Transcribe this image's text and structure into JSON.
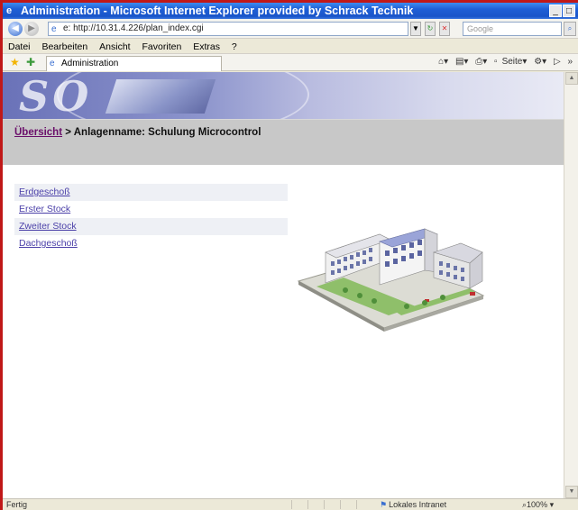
{
  "window": {
    "title": "Administration - Microsoft Internet Explorer provided by Schrack Technik",
    "minimize": "_",
    "restore": "□",
    "close": "X"
  },
  "address": {
    "url": "e: http://10.31.4.226/plan_index.cgi",
    "search_placeholder": "Google"
  },
  "menu": {
    "items": [
      "Datei",
      "Bearbeiten",
      "Ansicht",
      "Favoriten",
      "Extras",
      "?"
    ]
  },
  "tab": {
    "label": "Administration"
  },
  "command_bar": {
    "page": "Seite",
    "overflow": "»"
  },
  "banner": {
    "logo": "SO"
  },
  "breadcrumb": {
    "link": "Übersicht",
    "separator": " > ",
    "text": "Anlagenname: Schulung Microcontrol"
  },
  "floors": [
    "Erdgeschoß",
    "Erster Stock",
    "Zweiter Stock",
    "Dachgeschoß"
  ],
  "status": {
    "text": "Fertig",
    "zone": "Lokales Intranet",
    "zoom": "100%"
  },
  "colors": {
    "title_bar": "#1f5fd6",
    "breadcrumb_bar": "#c8c8c8",
    "link": "#4a3fa8",
    "breadcrumb_link": "#6a0f6a",
    "frame_border": "#c01818"
  }
}
